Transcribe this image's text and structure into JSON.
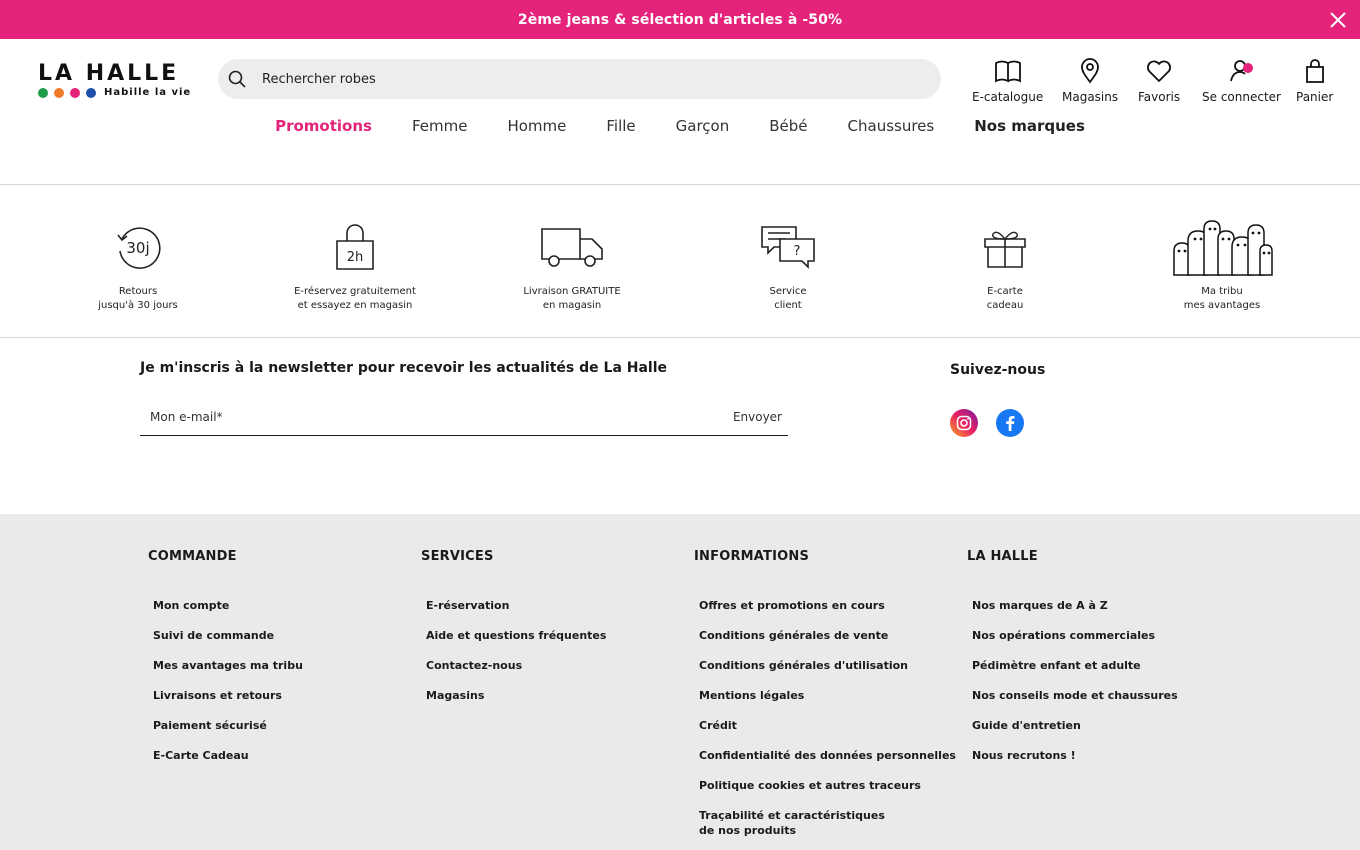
{
  "promo": {
    "text": "2ème jeans & sélection d'articles à -50%"
  },
  "brand": {
    "name": "LA HALLE",
    "tagline": "Habille la vie",
    "dots": [
      "#1e9e4a",
      "#f07a2a",
      "#e6237a",
      "#1f4fa8"
    ]
  },
  "search": {
    "prefix": "Rechercher ",
    "query": "robes"
  },
  "header_icons": [
    {
      "label": "E-catalogue",
      "icon": "book-icon"
    },
    {
      "label": "Magasins",
      "icon": "map-pin-icon"
    },
    {
      "label": "Favoris",
      "icon": "heart-icon"
    },
    {
      "label": "Se connecter",
      "icon": "user-icon"
    },
    {
      "label": "Panier",
      "icon": "bag-icon"
    }
  ],
  "nav": [
    "Promotions",
    "Femme",
    "Homme",
    "Fille",
    "Garçon",
    "Bébé",
    "Chaussures",
    "Nos marques"
  ],
  "reassurance": [
    {
      "label": "Retours\njusqu'à 30 jours",
      "icon": "returns-30-days-icon",
      "glyph": "30j"
    },
    {
      "label": "E-réservez gratuitement\net essayez en magasin",
      "icon": "reserve-bag-icon",
      "glyph": "2h"
    },
    {
      "label": "Livraison GRATUITE\nen magasin",
      "icon": "truck-icon"
    },
    {
      "label": "Service\nclient",
      "icon": "chat-bubbles-icon",
      "glyph": "?"
    },
    {
      "label": "E-carte\ncadeau",
      "icon": "gift-icon"
    },
    {
      "label": "Ma tribu\nmes avantages",
      "icon": "tribe-characters-icon"
    }
  ],
  "newsletter": {
    "title": "Je m'inscris à la newsletter pour recevoir les actualités de La Halle",
    "placeholder": "Mon e-mail*",
    "send": "Envoyer"
  },
  "follow": {
    "title": "Suivez-nous"
  },
  "colors": {
    "accent": "#e6237a",
    "footer_bg": "#ebeae8"
  },
  "footer": {
    "columns": [
      {
        "title": "COMMANDE",
        "links": [
          "Mon compte",
          "Suivi de commande",
          "Mes avantages ma tribu",
          "Livraisons et retours",
          "Paiement sécurisé",
          "E-Carte Cadeau"
        ]
      },
      {
        "title": "SERVICES",
        "links": [
          "E-réservation",
          "Aide et questions fréquentes",
          "Contactez-nous",
          "Magasins"
        ]
      },
      {
        "title": "INFORMATIONS",
        "links": [
          "Offres et promotions en cours",
          "Conditions générales de vente",
          "Conditions générales d'utilisation",
          "Mentions légales",
          "Crédit",
          "Confidentialité des données personnelles",
          "Politique cookies et autres traceurs",
          "Traçabilité et caractéristiques de nos produits"
        ]
      },
      {
        "title": "LA HALLE",
        "links": [
          "Nos marques de A à Z",
          "Nos opérations commerciales",
          "Pédimètre enfant et adulte",
          "Nos conseils mode et chaussures",
          "Guide d'entretien",
          "Nous recrutons !"
        ]
      }
    ]
  }
}
